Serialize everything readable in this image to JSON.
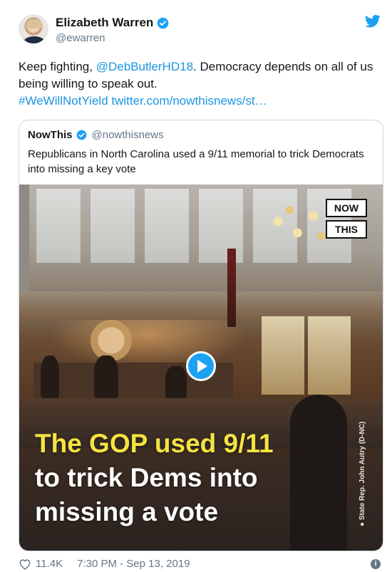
{
  "tweet": {
    "author_name": "Elizabeth Warren",
    "author_handle": "@ewarren",
    "text_before_mention": "Keep fighting, ",
    "mention": "@DebButlerHD18",
    "text_after_mention": ". Democracy depends on all of us being willing to speak out.",
    "hashtag": "#WeWillNotYield",
    "link": "twitter.com/nowthisnews/st…"
  },
  "quote": {
    "author_name": "NowThis",
    "author_handle": "@nowthisnews",
    "text": "Republicans in North Carolina used a 9/11 memorial to trick Democrats into missing a key vote"
  },
  "video": {
    "logo_line1": "NOW",
    "logo_line2": "THIS",
    "caption_yellow": "The GOP used 9/11",
    "caption_line2": "to trick Dems into",
    "caption_line3": "missing a vote",
    "credit": "State Rep. John Autry (D-NC)"
  },
  "footer": {
    "likes": "11.4K",
    "timestamp": "7:30 PM - Sep 13, 2019"
  },
  "colors": {
    "link": "#1b95e0",
    "verified": "#1da1f2",
    "caption_yellow": "#f5e342"
  },
  "icons": {
    "verified": "verified-badge-icon",
    "twitter": "twitter-bird-icon",
    "play": "play-icon",
    "like": "heart-icon",
    "info": "info-icon"
  }
}
